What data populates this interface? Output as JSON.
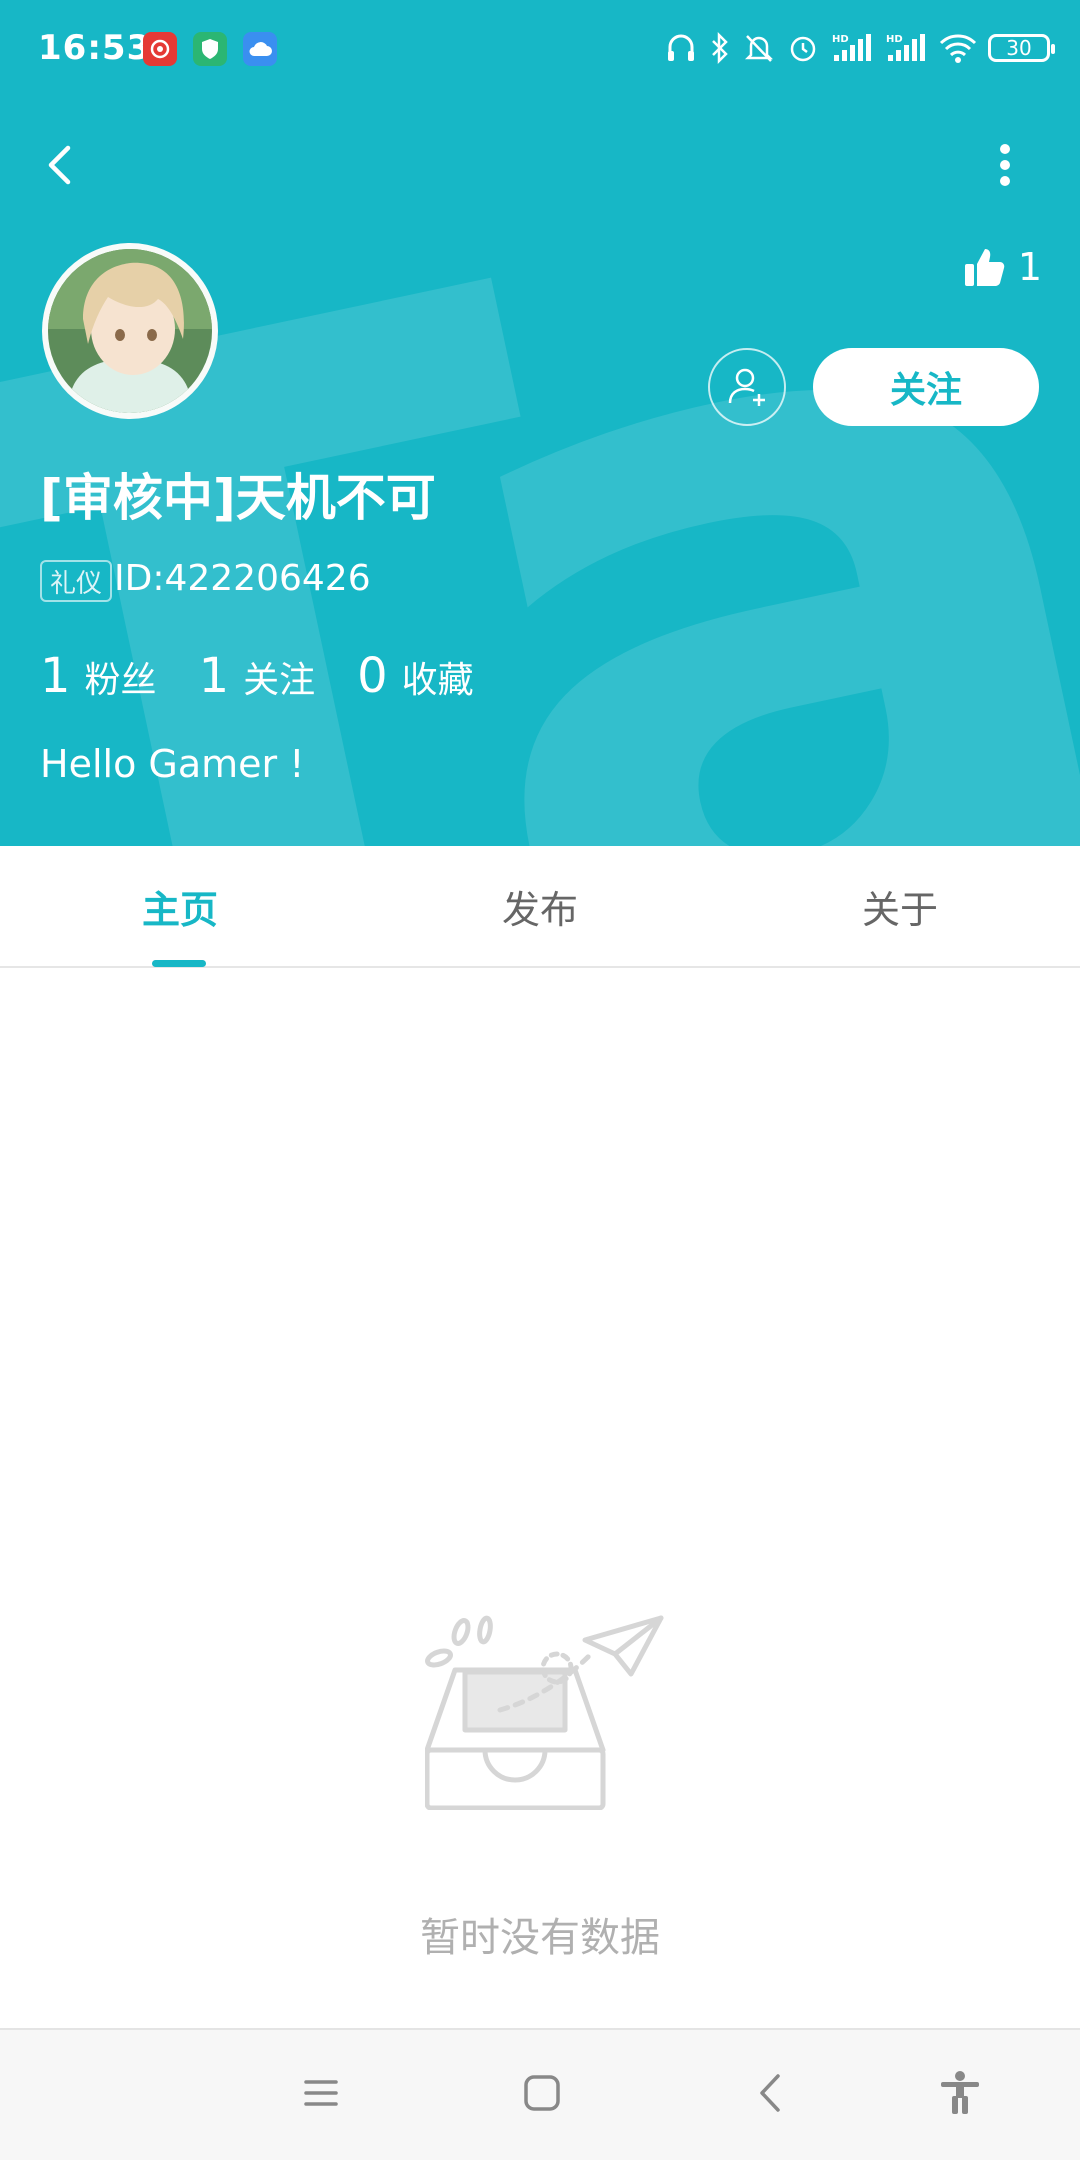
{
  "status_bar": {
    "time": "16:53",
    "apps": [
      "netease-music-icon",
      "security-shield-icon",
      "cloud-icon"
    ],
    "icons": [
      "headphone-icon",
      "bluetooth-icon",
      "mute-icon",
      "alarm-icon",
      "signal-hd-icon",
      "signal-hd-icon",
      "wifi-icon"
    ],
    "battery": "30"
  },
  "header": {
    "background_color": "#17b7c6",
    "likes_count": "1",
    "follow_label": "关注"
  },
  "profile": {
    "username": "[审核中]天机不可",
    "badge": "礼仪",
    "user_id": "ID:422206426",
    "stats": [
      {
        "num": "1",
        "label": "粉丝"
      },
      {
        "num": "1",
        "label": "关注"
      },
      {
        "num": "0",
        "label": "收藏"
      }
    ],
    "bio": "Hello Gamer !"
  },
  "tabs": [
    {
      "label": "主页",
      "active": true
    },
    {
      "label": "发布",
      "active": false
    },
    {
      "label": "关于",
      "active": false
    }
  ],
  "empty_state": {
    "text": "暂时没有数据"
  },
  "nav_bar": {
    "icons": [
      "menu-icon",
      "home-icon",
      "back-icon",
      "accessibility-icon"
    ]
  }
}
